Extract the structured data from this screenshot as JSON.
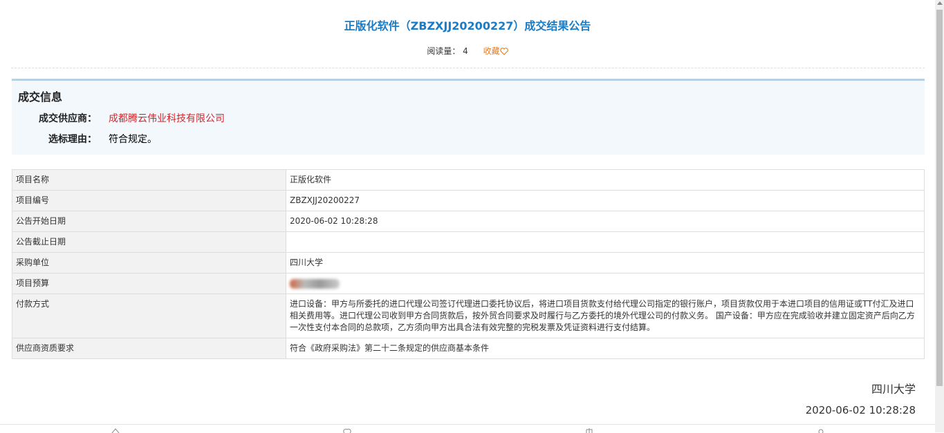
{
  "header": {
    "title": "正版化软件（ZBZXJJ20200227）成交结果公告",
    "read_label": "阅读量：",
    "read_count": "4",
    "favorite_label": "收藏"
  },
  "deal": {
    "heading": "成交信息",
    "supplier_label": "成交供应商：",
    "supplier_value": "成都腾云伟业科技有限公司",
    "reason_label": "选标理由：",
    "reason_value": "符合规定。"
  },
  "table": {
    "rows": [
      {
        "key": "项目名称",
        "value": "正版化软件"
      },
      {
        "key": "项目编号",
        "value": "ZBZXJJ20200227"
      },
      {
        "key": "公告开始日期",
        "value": "2020-06-02 10:28:28"
      },
      {
        "key": "公告截止日期",
        "value": ""
      },
      {
        "key": "采购单位",
        "value": "四川大学"
      },
      {
        "key": "项目预算",
        "value": ""
      },
      {
        "key": "付款方式",
        "value": "进口设备：甲方与所委托的进口代理公司签订代理进口委托协议后，将进口项目货款支付给代理公司指定的银行账户，项目货款仅用于本进口项目的信用证或TT付汇及进口相关费用等。进口代理公司收到甲方合同货款后，按外贸合同要求及时履行与乙方委托的境外代理公司的付款义务。 国产设备：甲方应在完成验收并建立固定资产后向乙方一次性支付本合同的总款项，乙方须向甲方出具合法有效完整的完税发票及凭证资料进行支付结算。"
      },
      {
        "key": "供应商资质要求",
        "value": "符合《政府采购法》第二十二条规定的供应商基本条件"
      }
    ]
  },
  "signature": {
    "org": "四川大学",
    "date": "2020-06-02 10:28:28"
  },
  "colors": {
    "title": "#1a7bc6",
    "favorite": "#e07b1e",
    "supplier": "#d0282d",
    "deal_bg": "#f2f8fc"
  }
}
